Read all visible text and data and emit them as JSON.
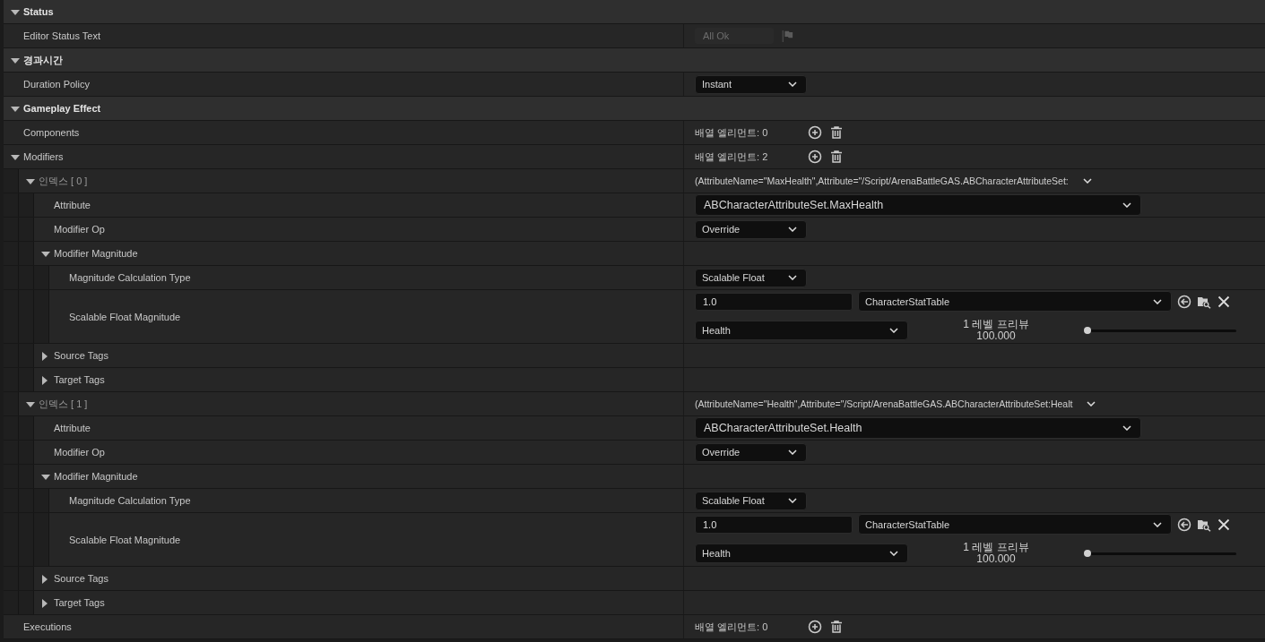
{
  "sections": [
    {
      "kind": "category",
      "label": "Status",
      "expanded": true,
      "children": [
        {
          "kind": "property",
          "label": "Editor Status Text",
          "value": {
            "kind": "readonly_text",
            "text": "All Ok"
          }
        }
      ]
    },
    {
      "kind": "category",
      "label": "경과시간",
      "expanded": true,
      "children": [
        {
          "kind": "property",
          "label": "Duration Policy",
          "value": {
            "kind": "combo",
            "text": "Instant"
          }
        }
      ]
    },
    {
      "kind": "category",
      "label": "Gameplay Effect",
      "expanded": true,
      "children": [
        {
          "kind": "property",
          "label": "Components",
          "value": {
            "kind": "array",
            "text": "배열 엘리먼트: 0"
          }
        },
        {
          "kind": "property",
          "label": "Modifiers",
          "expanded": true,
          "value": {
            "kind": "array",
            "text": "배열 엘리먼트: 2"
          },
          "children": [
            {
              "kind": "index",
              "label": "인덱스 [ 0 ]",
              "expanded": true,
              "value": {
                "kind": "struct",
                "text": "(AttributeName=\"MaxHealth\",Attribute=\"/Script/ArenaBattleGAS.ABCharacterAttributeSet:"
              },
              "children": [
                {
                  "kind": "property",
                  "label": "Attribute",
                  "value": {
                    "kind": "wide_combo",
                    "text": "ABCharacterAttributeSet.MaxHealth"
                  }
                },
                {
                  "kind": "property",
                  "label": "Modifier Op",
                  "value": {
                    "kind": "combo",
                    "text": "Override"
                  }
                },
                {
                  "kind": "property",
                  "label": "Modifier Magnitude",
                  "expanded": true,
                  "children": [
                    {
                      "kind": "property",
                      "label": "Magnitude Calculation Type",
                      "value": {
                        "kind": "combo",
                        "text": "Scalable Float"
                      }
                    },
                    {
                      "kind": "property",
                      "label": "Scalable Float Magnitude",
                      "value": {
                        "kind": "scalable",
                        "number": "1.0",
                        "table": "CharacterStatTable",
                        "row": "Health",
                        "preview_label": "1 레벨 프리뷰",
                        "preview_value": "100.000",
                        "level": 0
                      }
                    }
                  ]
                },
                {
                  "kind": "property",
                  "label": "Source Tags",
                  "expanded": false
                },
                {
                  "kind": "property",
                  "label": "Target Tags",
                  "expanded": false
                }
              ]
            },
            {
              "kind": "index",
              "label": "인덱스 [ 1 ]",
              "expanded": true,
              "value": {
                "kind": "struct",
                "text": "(AttributeName=\"Health\",Attribute=\"/Script/ArenaBattleGAS.ABCharacterAttributeSet:Healt"
              },
              "children": [
                {
                  "kind": "property",
                  "label": "Attribute",
                  "value": {
                    "kind": "wide_combo",
                    "text": "ABCharacterAttributeSet.Health"
                  }
                },
                {
                  "kind": "property",
                  "label": "Modifier Op",
                  "value": {
                    "kind": "combo",
                    "text": "Override"
                  }
                },
                {
                  "kind": "property",
                  "label": "Modifier Magnitude",
                  "expanded": true,
                  "children": [
                    {
                      "kind": "property",
                      "label": "Magnitude Calculation Type",
                      "value": {
                        "kind": "combo",
                        "text": "Scalable Float"
                      }
                    },
                    {
                      "kind": "property",
                      "label": "Scalable Float Magnitude",
                      "value": {
                        "kind": "scalable",
                        "number": "1.0",
                        "table": "CharacterStatTable",
                        "row": "Health",
                        "preview_label": "1 레벨 프리뷰",
                        "preview_value": "100.000",
                        "level": 0
                      }
                    }
                  ]
                },
                {
                  "kind": "property",
                  "label": "Source Tags",
                  "expanded": false
                },
                {
                  "kind": "property",
                  "label": "Target Tags",
                  "expanded": false
                }
              ]
            }
          ]
        },
        {
          "kind": "property",
          "label": "Executions",
          "value": {
            "kind": "array",
            "text": "배열 엘리먼트: 0"
          }
        }
      ]
    }
  ]
}
